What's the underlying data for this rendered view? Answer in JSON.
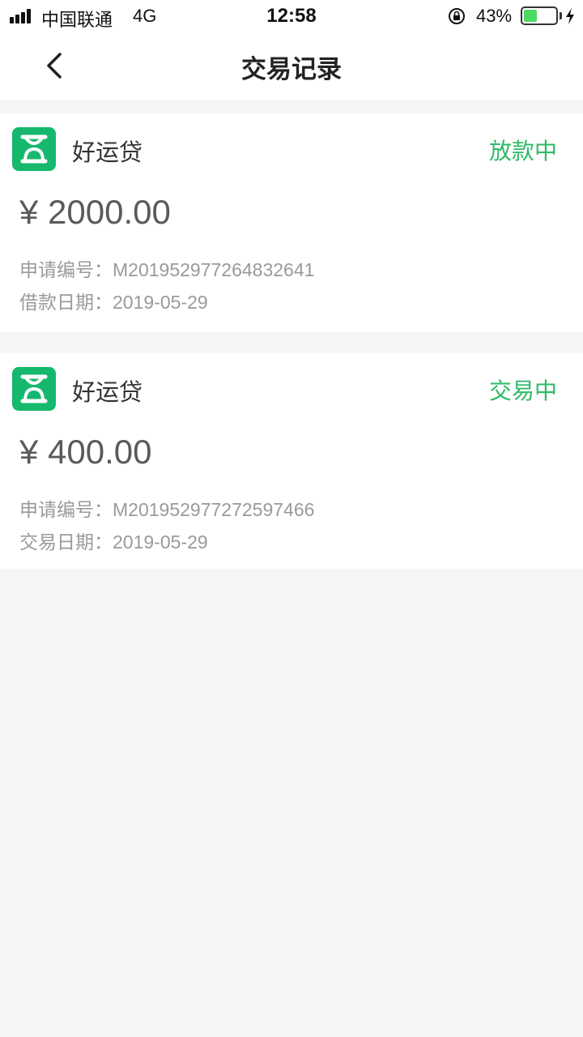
{
  "status_bar": {
    "carrier": "中国联通",
    "network": "4G",
    "time": "12:58",
    "battery_percent": "43%",
    "battery_level": 0.43,
    "battery_color": "#4cd964"
  },
  "nav": {
    "title": "交易记录",
    "back_icon": "chevron-left-icon"
  },
  "accent_color": "#2fba67",
  "records": [
    {
      "product": "好运贷",
      "status": "放款中",
      "amount": "¥ 2000.00",
      "app_no_label": "申请编号：",
      "app_no": "M201952977264832641",
      "date_label": "借款日期：",
      "date": "2019-05-29"
    },
    {
      "product": "好运贷",
      "status": "交易中",
      "amount": "¥ 400.00",
      "app_no_label": "申请编号：",
      "app_no": "M201952977272597466",
      "date_label": "交易日期：",
      "date": "2019-05-29"
    }
  ]
}
